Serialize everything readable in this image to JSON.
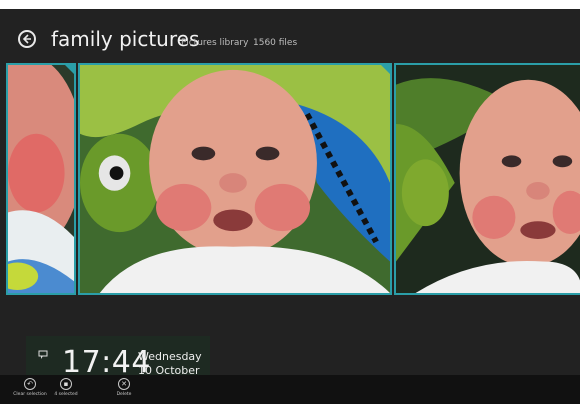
{
  "header": {
    "title": "family pictures",
    "library_label": "Pictures library",
    "file_count": "1560 files"
  },
  "photos": [
    {
      "name": "baby-photo-partial-left",
      "selected": true
    },
    {
      "name": "baby-photo-center",
      "selected": true
    },
    {
      "name": "baby-photo-right",
      "selected": false
    }
  ],
  "lock_clock": {
    "time": "17:44",
    "day": "Wednesday",
    "date": "10 October"
  },
  "appbar": {
    "clear_selection": "Clear selection",
    "selected": "4 selected",
    "delete": "Delete"
  },
  "colors": {
    "background": "#222222",
    "selection_accent": "#2b9ea8",
    "appbar": "#111111"
  }
}
